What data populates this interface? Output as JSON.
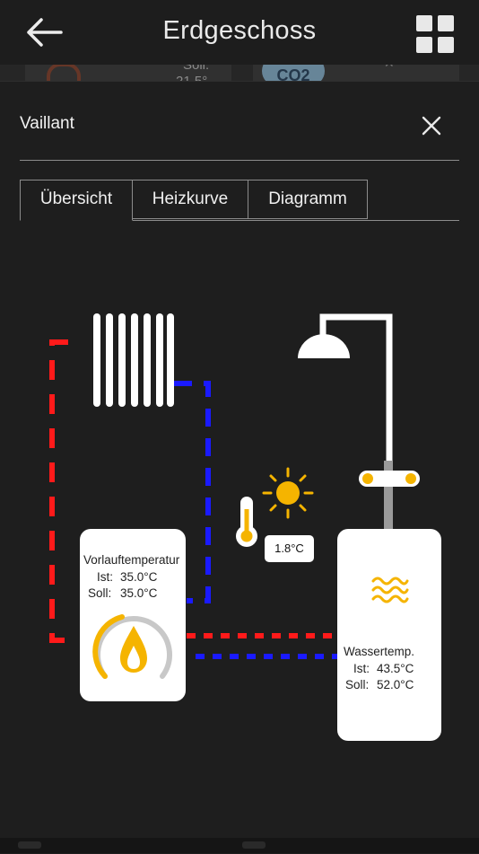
{
  "header": {
    "title": "Erdgeschoss",
    "back_icon": "arrow-left-icon",
    "menu_icon": "grid-icon"
  },
  "background_peek": {
    "soll_label": "Soll:",
    "soll_value": "21.5°",
    "co2_label": "CO2"
  },
  "dialog": {
    "title": "Vaillant",
    "close_icon": "close-icon",
    "tabs": [
      {
        "label": "Übersicht",
        "active": true
      },
      {
        "label": "Heizkurve",
        "active": false
      },
      {
        "label": "Diagramm",
        "active": false
      }
    ]
  },
  "heating": {
    "title": "Vorlauftemperatur",
    "ist_label": "Ist:",
    "ist_value": "35.0°C",
    "soll_label": "Soll:",
    "soll_value": "35.0°C",
    "icon": "flame-icon"
  },
  "outdoor": {
    "temperature": "1.8°C",
    "icons": [
      "thermometer-icon",
      "sun-icon"
    ]
  },
  "water": {
    "title": "Wassertemp.",
    "ist_label": "Ist:",
    "ist_value": "43.5°C",
    "soll_label": "Soll:",
    "soll_value": "52.0°C",
    "icon": "water-waves-icon"
  },
  "colors": {
    "supply_line": "#ff1a1a",
    "return_line": "#1a1aff",
    "accent": "#f5b400",
    "card": "#ffffff",
    "panel": "#1e1e1e"
  }
}
